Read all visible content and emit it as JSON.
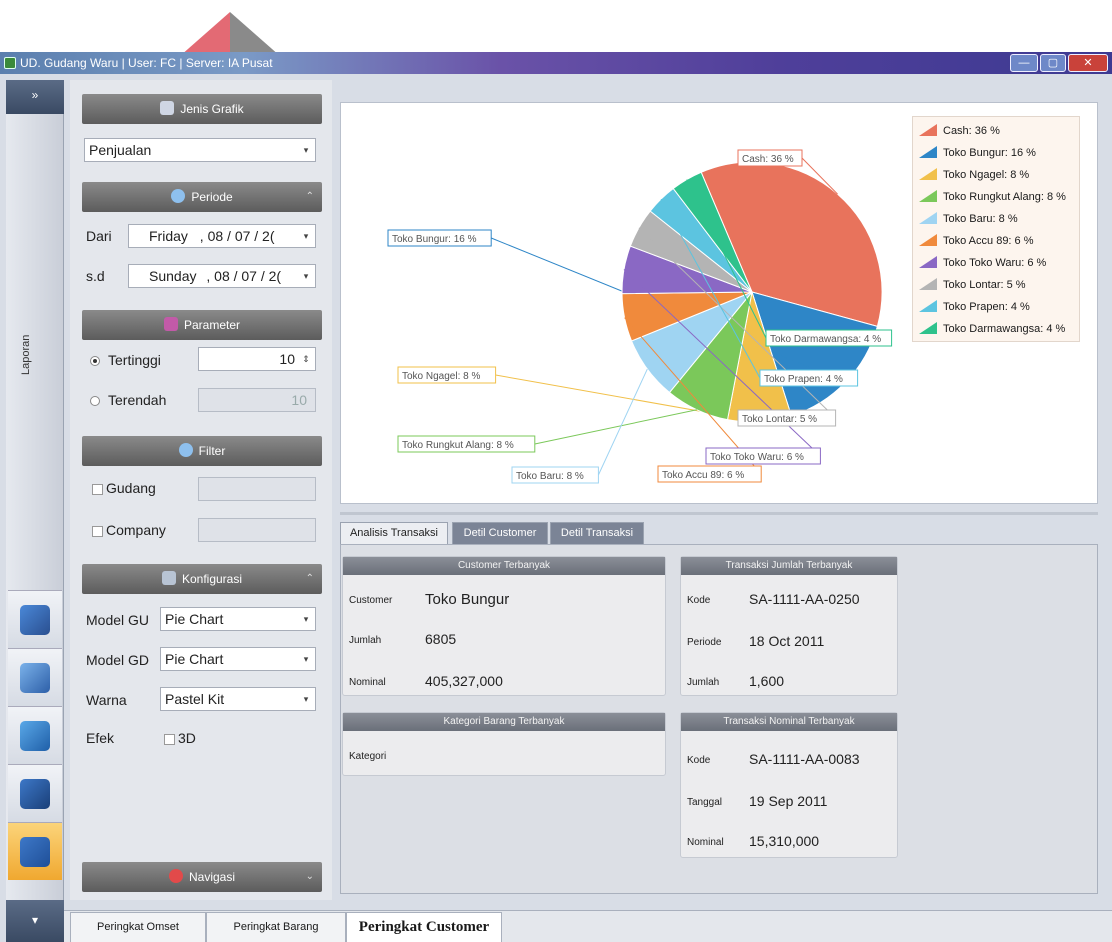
{
  "window": {
    "title": "UD. Gudang Waru  |  User: FC  |  Server: IA Pusat",
    "min": "—",
    "max": "▢",
    "close": "✕"
  },
  "leftbar": {
    "expand": "»",
    "label": "Laporan",
    "collapse": "▾"
  },
  "jenis_grafik": {
    "header": "Jenis Grafik",
    "value": "Penjualan"
  },
  "periode": {
    "header": "Periode",
    "dari_label": "Dari",
    "dari_day": "Friday",
    "dari_date": ", 08 / 07 / 2(",
    "sd_label": "s.d",
    "sd_day": "Sunday",
    "sd_date": ", 08 / 07 / 2("
  },
  "parameter": {
    "header": "Parameter",
    "tertinggi_label": "Tertinggi",
    "tertinggi_value": "10",
    "terendah_label": "Terendah",
    "terendah_value": "10"
  },
  "filter": {
    "header": "Filter",
    "gudang_label": "Gudang",
    "company_label": "Company"
  },
  "konfigurasi": {
    "header": "Konfigurasi",
    "model_gu_label": "Model GU",
    "model_gu_value": "Pie Chart",
    "model_gd_label": "Model GD",
    "model_gd_value": "Pie Chart",
    "warna_label": "Warna",
    "warna_value": "Pastel Kit",
    "efek_label": "Efek",
    "efek_value": "3D"
  },
  "navigasi": {
    "header": "Navigasi"
  },
  "chart_data": {
    "type": "pie",
    "slices": [
      {
        "label": "Cash",
        "value": 36,
        "color": "#e8735c",
        "callout": "Cash: 36 %",
        "legend": "Cash: 36 %"
      },
      {
        "label": "Toko Bungur",
        "value": 16,
        "color": "#2e86c7",
        "callout": "Toko Bungur: 16 %",
        "legend": "Toko Bungur: 16 %"
      },
      {
        "label": "Toko Ngagel",
        "value": 8,
        "color": "#f1c04a",
        "callout": "Toko Ngagel: 8 %",
        "legend": "Toko Ngagel: 8 %"
      },
      {
        "label": "Toko Rungkut Alang",
        "value": 8,
        "color": "#7bc85a",
        "callout": "Toko Rungkut Alang: 8 %",
        "legend": "Toko Rungkut Alang: 8 %"
      },
      {
        "label": "Toko Baru",
        "value": 8,
        "color": "#9fd4f2",
        "callout": "Toko Baru: 8 %",
        "legend": "Toko Baru: 8 %"
      },
      {
        "label": "Toko Accu 89",
        "value": 6,
        "color": "#f08a3c",
        "callout": "Toko Accu 89: 6 %",
        "legend": "Toko Accu 89: 6 %"
      },
      {
        "label": "Toko Toko Waru",
        "value": 6,
        "color": "#8a68c4",
        "callout": "Toko Toko Waru: 6 %",
        "legend": "Toko Toko Waru: 6 %"
      },
      {
        "label": "Toko Lontar",
        "value": 5,
        "color": "#b4b4b4",
        "callout": "Toko Lontar: 5 %",
        "legend": "Toko Lontar: 5 %"
      },
      {
        "label": "Toko Prapen",
        "value": 4,
        "color": "#5cc4e0",
        "callout": "Toko Prapen: 4 %",
        "legend": "Toko Prapen: 4 %"
      },
      {
        "label": "Toko Darmawangsa",
        "value": 4,
        "color": "#2ec28c",
        "callout": "Toko Darmawangsa: 4 %",
        "legend": "Toko Darmawangsa: 4 %"
      }
    ],
    "legend_position": "top-right"
  },
  "tabs": {
    "analisis": "Analisis Transaksi",
    "customer": "Detil Customer",
    "transaksi": "Detil Transaksi"
  },
  "customer_terbanyak": {
    "header": "Customer Terbanyak",
    "customer_label": "Customer",
    "customer_value": "Toko Bungur",
    "jumlah_label": "Jumlah",
    "jumlah_value": "6805",
    "nominal_label": "Nominal",
    "nominal_value": "405,327,000"
  },
  "kategori_terbanyak": {
    "header": "Kategori Barang Terbanyak",
    "kategori_label": "Kategori"
  },
  "transaksi_jumlah": {
    "header": "Transaksi Jumlah Terbanyak",
    "kode_label": "Kode",
    "kode_value": "SA-1111-AA-0250",
    "periode_label": "Periode",
    "periode_value": "18 Oct 2011",
    "jumlah_label": "Jumlah",
    "jumlah_value": "1,600"
  },
  "transaksi_nominal": {
    "header": "Transaksi Nominal Terbanyak",
    "kode_label": "Kode",
    "kode_value": "SA-1111-AA-0083",
    "tanggal_label": "Tanggal",
    "tanggal_value": "19 Sep 2011",
    "nominal_label": "Nominal",
    "nominal_value": "15,310,000"
  },
  "bottom_tabs": {
    "omset": "Peringkat Omset",
    "barang": "Peringkat Barang",
    "customer": "Peringkat Customer"
  }
}
